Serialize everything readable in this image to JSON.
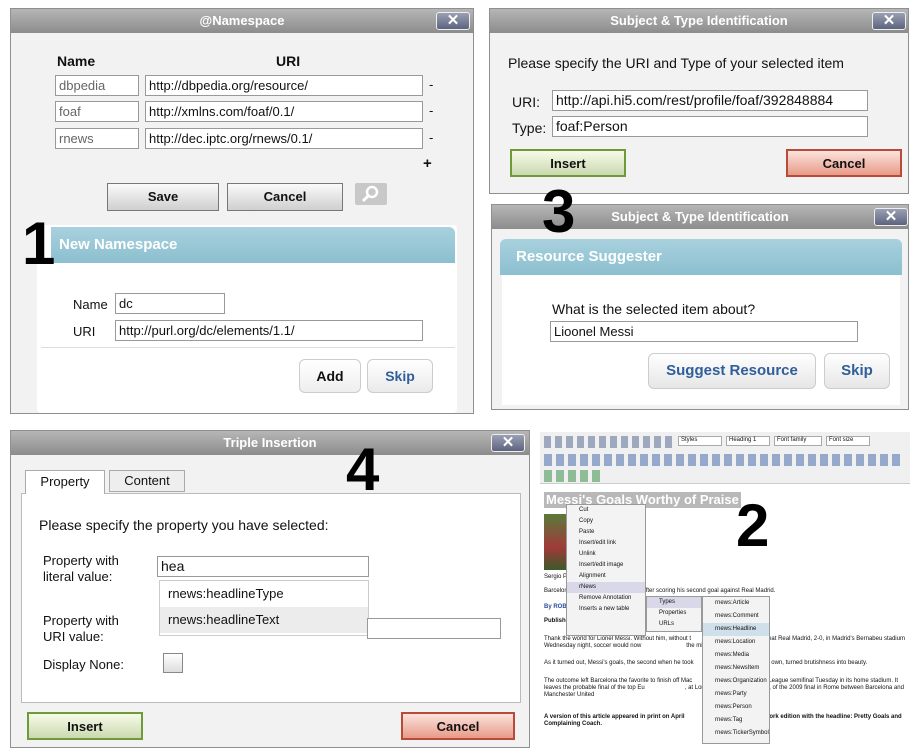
{
  "steps": {
    "one": "1",
    "two": "2",
    "three": "3",
    "four": "4"
  },
  "namespace": {
    "title": "@Namespace",
    "close": "✕",
    "col_name": "Name",
    "col_uri": "URI",
    "rows": [
      {
        "prefix": "dbpedia",
        "uri": "http://dbpedia.org/resource/",
        "remove": "-"
      },
      {
        "prefix": "foaf",
        "uri": "http://xmlns.com/foaf/0.1/",
        "remove": "-"
      },
      {
        "prefix": "rnews",
        "uri": "http://dec.iptc.org/rnews/0.1/",
        "remove": "-"
      }
    ],
    "add": "+",
    "save": "Save",
    "cancel": "Cancel",
    "new_title": "New Namespace",
    "name_label": "Name",
    "name_value": "dc",
    "uri_label": "URI",
    "uri_value": "http://purl.org/dc/elements/1.1/",
    "add_btn": "Add",
    "skip_btn": "Skip"
  },
  "subject": {
    "title": "Subject & Type Identification",
    "close": "✕",
    "prompt": "Please specify the URI and Type of your selected item",
    "uri_label": "URI:",
    "uri_value": "http://api.hi5.com/rest/profile/foaf/392848884",
    "type_label": "Type:",
    "type_value": "foaf:Person",
    "insert": "Insert",
    "cancel": "Cancel"
  },
  "suggester": {
    "title": "Subject & Type Identification",
    "close": "✕",
    "band": "Resource Suggester",
    "question": "What is the selected item about?",
    "value": "Lioonel Messi",
    "suggest": "Suggest Resource",
    "skip": "Skip"
  },
  "triple": {
    "title": "Triple Insertion",
    "close": "✕",
    "tab_property": "Property",
    "tab_content": "Content",
    "prompt": "Please specify the property you have selected:",
    "literal_label1": "Property with",
    "literal_label2": "literal value:",
    "literal_value": "hea",
    "suggestions": [
      "rnews:headlineType",
      "rnews:headlineText"
    ],
    "uri_label1": "Property with",
    "uri_label2": "URI value:",
    "display_none": "Display None:",
    "insert": "Insert",
    "cancel": "Cancel"
  },
  "editor": {
    "toolbar": {
      "styles": "Styles",
      "heading": "Heading 1",
      "font_family": "Font family",
      "font_size": "Font size"
    },
    "headline": "Messi's Goals Worthy of Praise",
    "caption": "Sergio P",
    "para1": "Barcelon                                       tes after scoring his second goal against Real Madrid.",
    "byline": "By ROB H",
    "published": "Publisheo",
    "para2": "Thank the world for Lionel Messi. Without him, without t                       Barcelona to beat Real Madrid, 2-0, in Madrid's Bernabeu stadium Wednesday night, soccer would now                           the millionaires' game.",
    "para3": "As it turned out, Messi's goals, the second when he took                                    on his own, turned brutishness into beauty.",
    "para4": "The outcome left Barcelona the favorite to finish off Mac                             hampions League semifinal Tuesday in its home stadium. It leaves the probable final of the top Eu                        , at London's Wembley Stadium, of the 2009 final in Rome between Barcelona and Manchester United",
    "para5": "A version of this article appeared in print on April                                  the New York edition with the headline: Pretty Goals and Complaining Coach.",
    "context_menu": [
      "Cut",
      "Copy",
      "Paste",
      "Insert/edit link",
      "Unlink",
      "Insert/edit image",
      "Alignment",
      "rNews",
      "Remove Annotation",
      "Inserts a new table"
    ],
    "sub_menu": [
      "Types",
      "Properties",
      "URLs"
    ],
    "types_menu": [
      "rnews:Article",
      "rnews:Comment",
      "rnews:Headline",
      "rnews:Location",
      "rnews:Media",
      "rnews:NewsItem",
      "rnews:Organization",
      "rnews:Party",
      "rnews:Person",
      "rnews:Tag",
      "rnews:TickerSymbol"
    ]
  }
}
